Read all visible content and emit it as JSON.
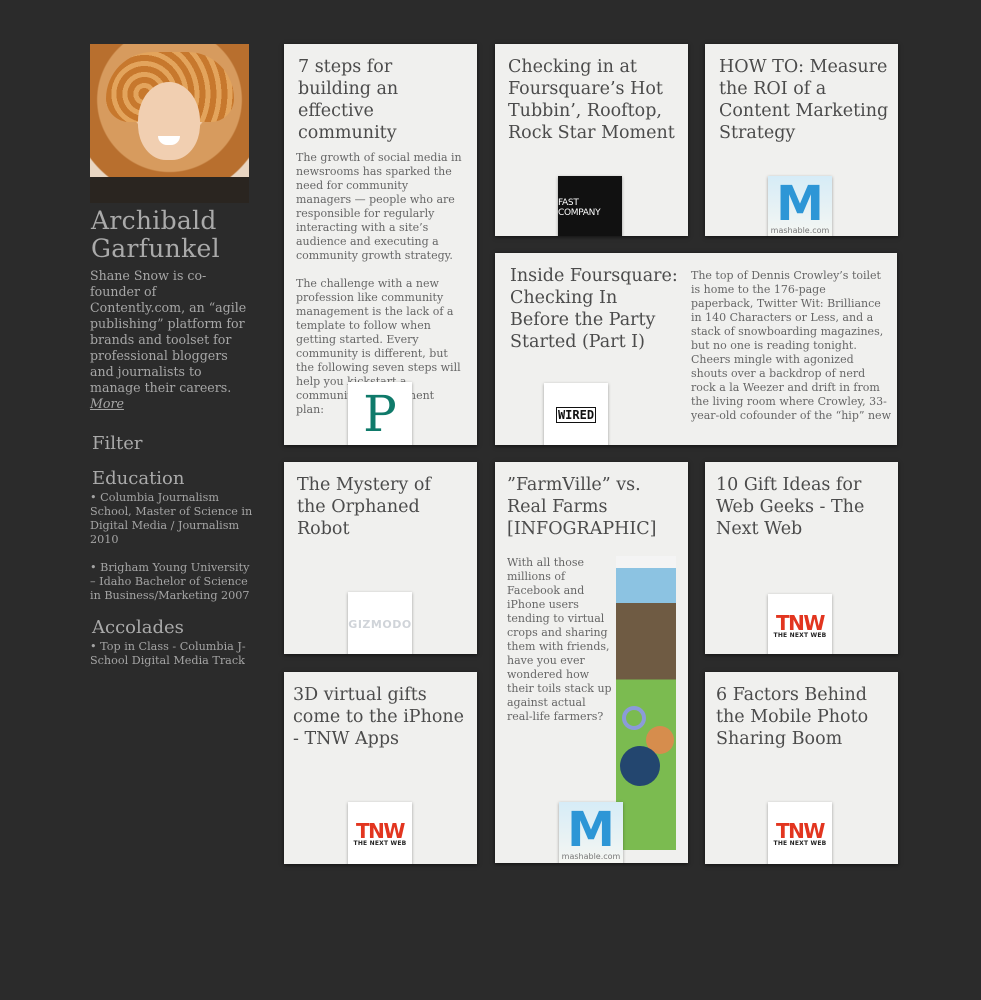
{
  "profile": {
    "name": "Archibald Garfunkel",
    "bio": "Shane Snow is co-founder of Contently.com, an “agile publishing” platform for brands and toolset for professional bloggers and journalists to manage their careers.",
    "more_label": "More",
    "filter_label": "Filter",
    "education_label": "Education",
    "education": [
      "• Columbia Journalism School, Master of Science in Digital Media / Journalism 2010",
      "• Brigham Young University – Idaho Bachelor of Science in Business/Marketing 2007"
    ],
    "accolades_label": "Accolades",
    "accolades": [
      "• Top in Class - Columbia J-School Digital Media Track"
    ]
  },
  "cards": [
    {
      "title": "7 steps for building an effective community",
      "body1": "The growth of social media in newsrooms has sparked the need for community managers — people who are responsible for regularly interacting with a site’s audience and executing a community growth strategy.",
      "body2": "The challenge with a new profession like community management is the lack of a template to follow when getting started. Every community is different, but the following seven steps will help you kickstart a community management plan:",
      "source_icon": "poynter-logo"
    },
    {
      "title": "Checking in at Foursquare’s Hot Tubbin’, Rooftop, Rock Star Moment",
      "source_icon": "fast-company-logo",
      "logo_text": "FAST COMPANY"
    },
    {
      "title": "HOW TO: Measure the ROI of a Content Marketing Strategy",
      "source_icon": "mashable-logo",
      "logo_text": "mashable.com"
    },
    {
      "title": "Inside Foursquare: Checking In Before the Party Started (Part I)",
      "body": "The top of Dennis Crowley’s toilet is home to the 176-page paperback, Twitter Wit: Brilliance in 140 Characters or Less, and a stack of snowboarding magazines, but no one is reading tonight. Cheers mingle with agonized shouts over a backdrop of nerd rock a la Weezer and drift in from the living room where Crowley, 33-year-old cofounder of the “hip” new",
      "source_icon": "wired-logo",
      "logo_text": "WIRED"
    },
    {
      "title": "The Mystery of the Orphaned Robot",
      "source_icon": "gizmodo-logo",
      "logo_text": "GIZMODO"
    },
    {
      "title": "”FarmVille” vs. Real Farms [INFOGRAPHIC]",
      "body": "With all those millions of Facebook and iPhone users tending to virtual crops and sharing them with friends, have you ever wondered how their toils stack up against actual real-life farmers?",
      "source_icon": "mashable-logo",
      "logo_text": "mashable.com"
    },
    {
      "title": "10 Gift Ideas for Web Geeks - The Next Web",
      "source_icon": "tnw-logo",
      "logo_text": "TNW",
      "logo_sub": "THE NEXT WEB"
    },
    {
      "title": "3D virtual gifts come to the iPhone - TNW Apps",
      "source_icon": "tnw-logo",
      "logo_text": "TNW",
      "logo_sub": "THE NEXT WEB"
    },
    {
      "title": "6 Factors Behind the Mobile Photo Sharing Boom",
      "source_icon": "tnw-logo",
      "logo_text": "TNW",
      "logo_sub": "THE NEXT WEB"
    }
  ],
  "colors": {
    "background": "#2b2b2b",
    "card": "#f0f0ee",
    "sidebar_text": "#aaaaaa"
  }
}
